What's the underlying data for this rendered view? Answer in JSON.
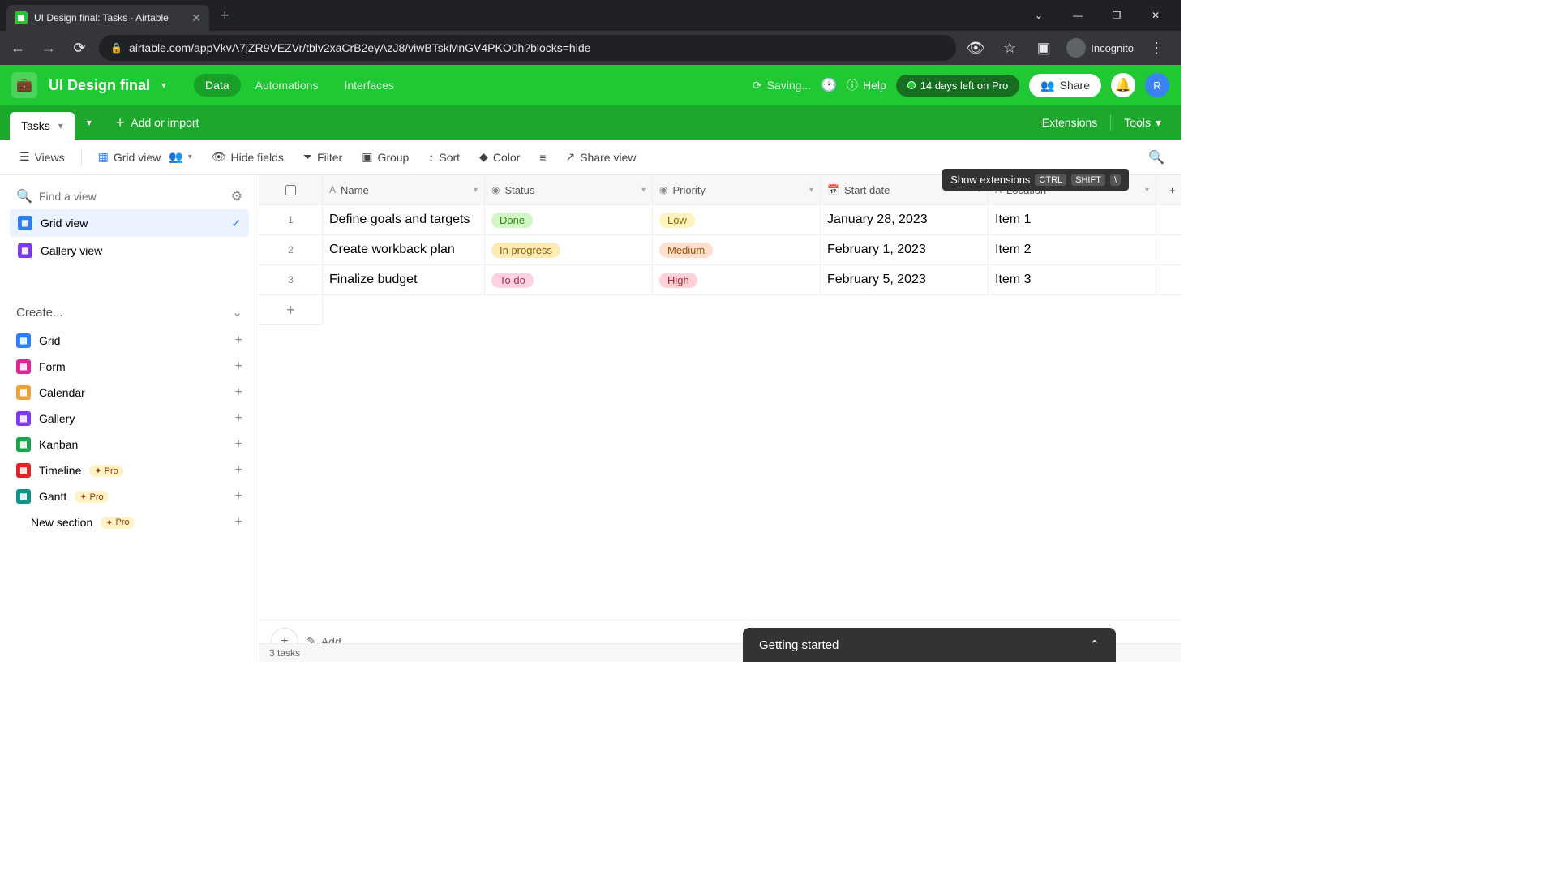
{
  "browser": {
    "tab_title": "UI Design final: Tasks - Airtable",
    "url": "airtable.com/appVkvA7jZR9VEZVr/tblv2xaCrB2eyAzJ8/viwBTskMnGV4PKO0h?blocks=hide",
    "incognito_label": "Incognito"
  },
  "header": {
    "base_name": "UI Design final",
    "tabs": [
      "Data",
      "Automations",
      "Interfaces"
    ],
    "saving": "Saving...",
    "help": "Help",
    "trial": "14 days left on Pro",
    "share": "Share",
    "avatar_letter": "R"
  },
  "table_tabs": {
    "active": "Tasks",
    "add_import": "Add or import",
    "extensions": "Extensions",
    "tools": "Tools"
  },
  "toolbar": {
    "views": "Views",
    "grid_view": "Grid view",
    "hide_fields": "Hide fields",
    "filter": "Filter",
    "group": "Group",
    "sort": "Sort",
    "color": "Color",
    "share_view": "Share view"
  },
  "tooltip": {
    "text": "Show extensions",
    "k1": "CTRL",
    "k2": "SHIFT",
    "k3": "\\"
  },
  "sidebar": {
    "find_placeholder": "Find a view",
    "views": [
      {
        "label": "Grid view",
        "active": true,
        "color": "#2d7ff9"
      },
      {
        "label": "Gallery view",
        "active": false,
        "color": "#7c3aed"
      }
    ],
    "create": "Create...",
    "view_types": [
      {
        "label": "Grid",
        "color": "#2d7ff9",
        "pro": false
      },
      {
        "label": "Form",
        "color": "#dc2696",
        "pro": false
      },
      {
        "label": "Calendar",
        "color": "#e8a23d",
        "pro": false
      },
      {
        "label": "Gallery",
        "color": "#7c3aed",
        "pro": false
      },
      {
        "label": "Kanban",
        "color": "#16a34a",
        "pro": false
      },
      {
        "label": "Timeline",
        "color": "#dc2626",
        "pro": true
      },
      {
        "label": "Gantt",
        "color": "#0d9488",
        "pro": true
      }
    ],
    "new_section": "New section",
    "pro_label": "Pro"
  },
  "grid": {
    "columns": [
      "Name",
      "Status",
      "Priority",
      "Start date",
      "Location"
    ],
    "rows": [
      {
        "name": "Define goals and targets",
        "status": {
          "label": "Done",
          "bg": "#d1f7c4",
          "fg": "#338a17"
        },
        "priority": {
          "label": "Low",
          "bg": "#fff3bf",
          "fg": "#8a6d00"
        },
        "date": "January 28, 2023",
        "location": "Item 1"
      },
      {
        "name": "Create workback plan",
        "status": {
          "label": "In progress",
          "bg": "#ffeab6",
          "fg": "#8a6200"
        },
        "priority": {
          "label": "Medium",
          "bg": "#ffe0cc",
          "fg": "#a14e00"
        },
        "date": "February 1, 2023",
        "location": "Item 2"
      },
      {
        "name": "Finalize budget",
        "status": {
          "label": "To do",
          "bg": "#ffd1e1",
          "fg": "#a1305a"
        },
        "priority": {
          "label": "High",
          "bg": "#ffd1d9",
          "fg": "#a13037"
        },
        "date": "February 5, 2023",
        "location": "Item 3"
      }
    ],
    "add_placeholder": "Add...",
    "count_label": "3 tasks"
  },
  "getting_started": "Getting started"
}
